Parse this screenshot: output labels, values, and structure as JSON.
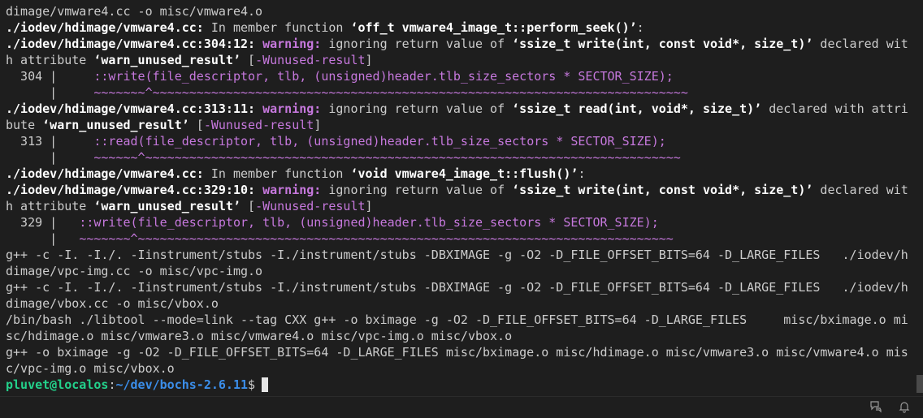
{
  "terminal": {
    "lines": [
      [
        {
          "c": "plain",
          "t": "dimage/vmware4.cc -o misc/vmware4.o"
        }
      ],
      [
        {
          "c": "b",
          "t": "./iodev/hdimage/vmware4.cc:"
        },
        {
          "c": "plain",
          "t": " In member function "
        },
        {
          "c": "q",
          "t": "‘off_t vmware4_image_t::perform_seek()’"
        },
        {
          "c": "plain",
          "t": ":"
        }
      ],
      [
        {
          "c": "b",
          "t": "./iodev/hdimage/vmware4.cc:304:12:"
        },
        {
          "c": "plain",
          "t": " "
        },
        {
          "c": "warn",
          "t": "warning:"
        },
        {
          "c": "plain",
          "t": " ignoring return value of "
        },
        {
          "c": "q",
          "t": "‘ssize_t write(int, const void*, size_t)’"
        },
        {
          "c": "plain",
          "t": " declared wit"
        }
      ],
      [
        {
          "c": "plain",
          "t": "h attribute "
        },
        {
          "c": "q",
          "t": "‘warn_unused_result’"
        },
        {
          "c": "plain",
          "t": " ["
        },
        {
          "c": "flag",
          "t": "-Wunused-result"
        },
        {
          "c": "plain",
          "t": "]"
        }
      ],
      [
        {
          "c": "gutter",
          "t": "  304 |     "
        },
        {
          "c": "src",
          "t": "::write(file_descriptor, tlb, (unsigned)header.tlb_size_sectors * SECTOR_SIZE);"
        }
      ],
      [
        {
          "c": "gutter",
          "t": "      |     "
        },
        {
          "c": "tilde",
          "t": "~~~~~~~^~~~~~~~~~~~~~~~~~~~~~~~~~~~~~~~~~~~~~~~~~~~~~~~~~~~~~~~~~~~~~~~~~~~~~~~~~"
        }
      ],
      [
        {
          "c": "b",
          "t": "./iodev/hdimage/vmware4.cc:313:11:"
        },
        {
          "c": "plain",
          "t": " "
        },
        {
          "c": "warn",
          "t": "warning:"
        },
        {
          "c": "plain",
          "t": " ignoring return value of "
        },
        {
          "c": "q",
          "t": "‘ssize_t read(int, void*, size_t)’"
        },
        {
          "c": "plain",
          "t": " declared with attri"
        }
      ],
      [
        {
          "c": "plain",
          "t": "bute "
        },
        {
          "c": "q",
          "t": "‘warn_unused_result’"
        },
        {
          "c": "plain",
          "t": " ["
        },
        {
          "c": "flag",
          "t": "-Wunused-result"
        },
        {
          "c": "plain",
          "t": "]"
        }
      ],
      [
        {
          "c": "gutter",
          "t": "  313 |     "
        },
        {
          "c": "src",
          "t": "::read(file_descriptor, tlb, (unsigned)header.tlb_size_sectors * SECTOR_SIZE);"
        }
      ],
      [
        {
          "c": "gutter",
          "t": "      |     "
        },
        {
          "c": "tilde",
          "t": "~~~~~~^~~~~~~~~~~~~~~~~~~~~~~~~~~~~~~~~~~~~~~~~~~~~~~~~~~~~~~~~~~~~~~~~~~~~~~~~~"
        }
      ],
      [
        {
          "c": "b",
          "t": "./iodev/hdimage/vmware4.cc:"
        },
        {
          "c": "plain",
          "t": " In member function "
        },
        {
          "c": "q",
          "t": "‘void vmware4_image_t::flush()’"
        },
        {
          "c": "plain",
          "t": ":"
        }
      ],
      [
        {
          "c": "b",
          "t": "./iodev/hdimage/vmware4.cc:329:10:"
        },
        {
          "c": "plain",
          "t": " "
        },
        {
          "c": "warn",
          "t": "warning:"
        },
        {
          "c": "plain",
          "t": " ignoring return value of "
        },
        {
          "c": "q",
          "t": "‘ssize_t write(int, const void*, size_t)’"
        },
        {
          "c": "plain",
          "t": " declared wit"
        }
      ],
      [
        {
          "c": "plain",
          "t": "h attribute "
        },
        {
          "c": "q",
          "t": "‘warn_unused_result’"
        },
        {
          "c": "plain",
          "t": " ["
        },
        {
          "c": "flag",
          "t": "-Wunused-result"
        },
        {
          "c": "plain",
          "t": "]"
        }
      ],
      [
        {
          "c": "gutter",
          "t": "  329 |   "
        },
        {
          "c": "src",
          "t": "::write(file_descriptor, tlb, (unsigned)header.tlb_size_sectors * SECTOR_SIZE);"
        }
      ],
      [
        {
          "c": "gutter",
          "t": "      |   "
        },
        {
          "c": "tilde",
          "t": "~~~~~~~^~~~~~~~~~~~~~~~~~~~~~~~~~~~~~~~~~~~~~~~~~~~~~~~~~~~~~~~~~~~~~~~~~~~~~~~~~"
        }
      ],
      [
        {
          "c": "plain",
          "t": "g++ -c -I. -I./. -Iinstrument/stubs -I./instrument/stubs -DBXIMAGE -g -O2 -D_FILE_OFFSET_BITS=64 -D_LARGE_FILES   ./iodev/h"
        }
      ],
      [
        {
          "c": "plain",
          "t": "dimage/vpc-img.cc -o misc/vpc-img.o"
        }
      ],
      [
        {
          "c": "plain",
          "t": "g++ -c -I. -I./. -Iinstrument/stubs -I./instrument/stubs -DBXIMAGE -g -O2 -D_FILE_OFFSET_BITS=64 -D_LARGE_FILES   ./iodev/h"
        }
      ],
      [
        {
          "c": "plain",
          "t": "dimage/vbox.cc -o misc/vbox.o"
        }
      ],
      [
        {
          "c": "plain",
          "t": "/bin/bash ./libtool --mode=link --tag CXX g++ -o bximage -g -O2 -D_FILE_OFFSET_BITS=64 -D_LARGE_FILES     misc/bximage.o mi"
        }
      ],
      [
        {
          "c": "plain",
          "t": "sc/hdimage.o misc/vmware3.o misc/vmware4.o misc/vpc-img.o misc/vbox.o"
        }
      ],
      [
        {
          "c": "plain",
          "t": "g++ -o bximage -g -O2 -D_FILE_OFFSET_BITS=64 -D_LARGE_FILES misc/bximage.o misc/hdimage.o misc/vmware3.o misc/vmware4.o mis"
        }
      ],
      [
        {
          "c": "plain",
          "t": "c/vpc-img.o misc/vbox.o"
        }
      ]
    ],
    "prompt": {
      "user_host": "pluvet@localos",
      "sep": ":",
      "path": "~/dev/bochs-2.6.11",
      "symbol": "$"
    }
  },
  "statusbar": {
    "icons": [
      "feedback-icon",
      "bell-icon"
    ]
  },
  "colors": {
    "background": "#1e1e1e",
    "text": "#cccccc",
    "accent_purple": "#c678dd",
    "prompt_green": "#23d18b",
    "prompt_blue": "#3b8eea"
  }
}
